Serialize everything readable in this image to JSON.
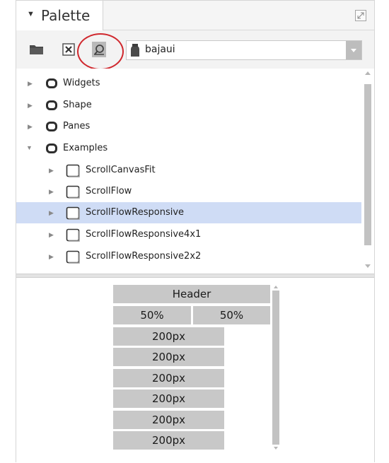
{
  "palette": {
    "title": "Palette",
    "module": "bajaui"
  },
  "tree": {
    "items": [
      {
        "label": "Widgets"
      },
      {
        "label": "Shape"
      },
      {
        "label": "Panes"
      },
      {
        "label": "Examples"
      },
      {
        "label": "ScrollCanvasFit"
      },
      {
        "label": "ScrollFlow"
      },
      {
        "label": "ScrollFlowResponsive"
      },
      {
        "label": "ScrollFlowResponsive4x1"
      },
      {
        "label": "ScrollFlowResponsive2x2"
      }
    ],
    "selected": "ScrollFlowResponsive"
  },
  "preview": {
    "header": "Header",
    "half_left": "50%",
    "half_right": "50%",
    "items": [
      "200px",
      "200px",
      "200px",
      "200px",
      "200px",
      "200px"
    ]
  },
  "colors": {
    "selection": "#cfdcf5",
    "highlight": "#d0282e",
    "preview_cell": "#c8c8c8"
  }
}
